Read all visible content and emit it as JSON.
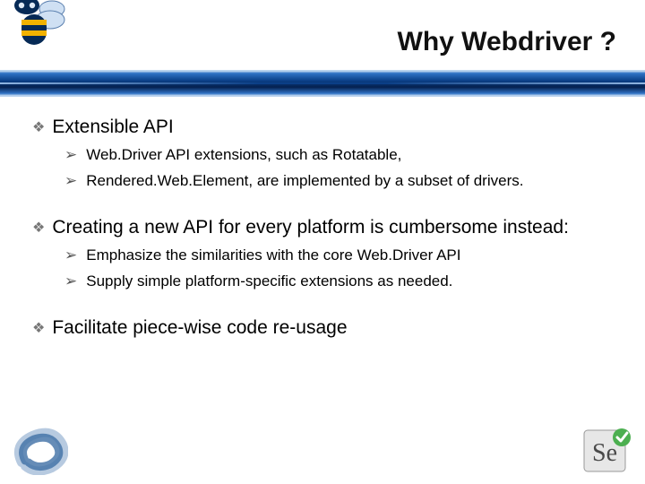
{
  "header": {
    "title": "Why Webdriver ?"
  },
  "bullets": {
    "b1": {
      "label": "Extensible API",
      "subs": [
        "Web.Driver API extensions, such as Rotatable,",
        "Rendered.Web.Element, are implemented by a subset of drivers."
      ]
    },
    "b2": {
      "label": "Creating a new API for every platform is cumbersome instead:",
      "subs": [
        "Emphasize the similarities with the core Web.Driver API",
        "Supply simple platform-specific extensions as needed."
      ]
    },
    "b3": {
      "label": "Facilitate piece-wise code re-usage"
    }
  },
  "icons": {
    "bee": "bee-logo-icon",
    "swirl": "swirl-icon",
    "selenium": "selenium-logo-icon"
  }
}
